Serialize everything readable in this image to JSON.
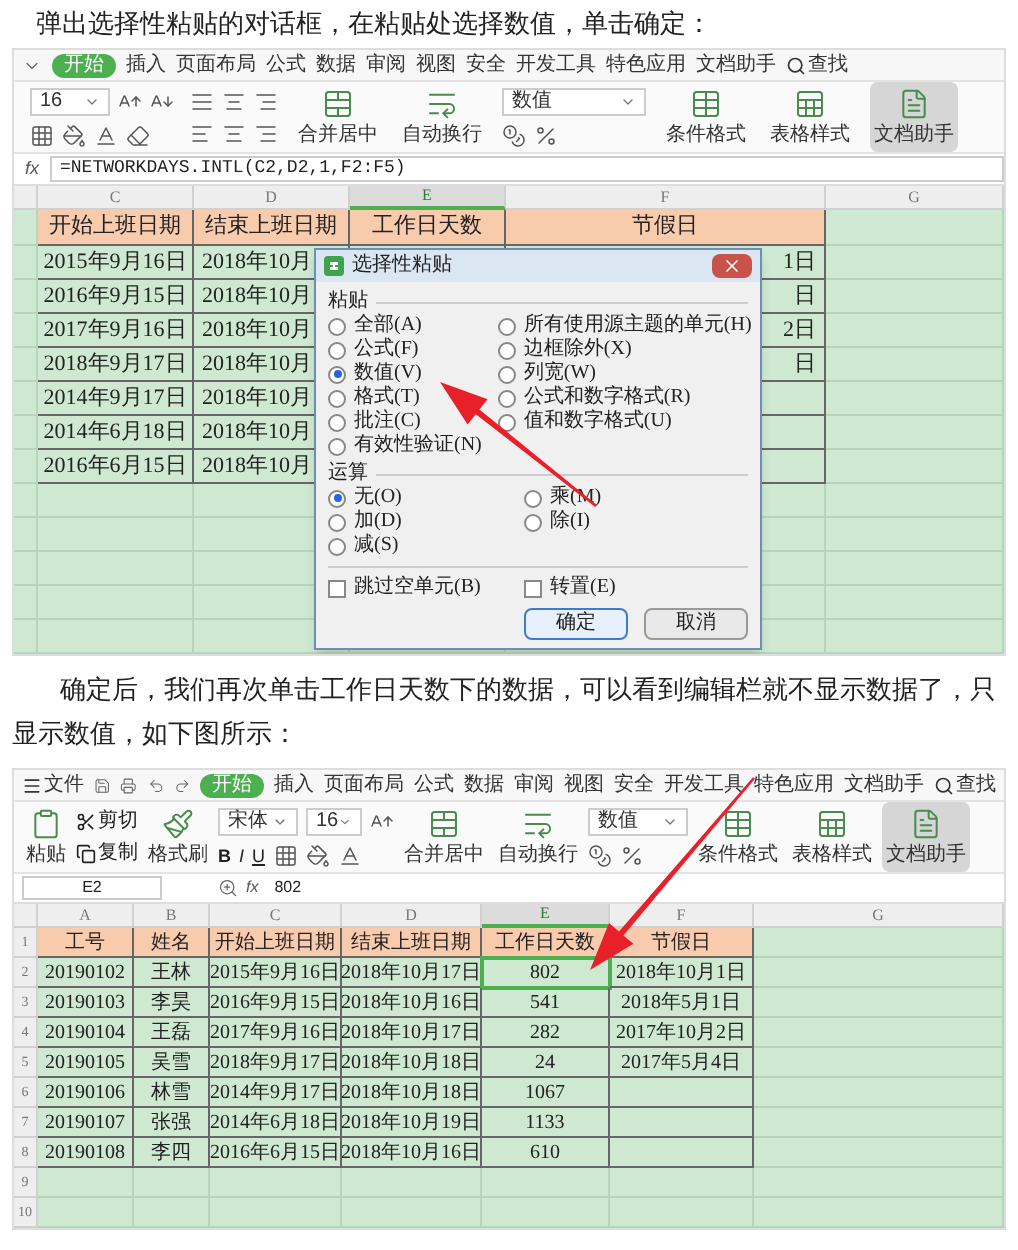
{
  "intro": "弹出选择性粘贴的对话框，在粘贴处选择数值，单击确定：",
  "screenshot_1": {
    "tabs": [
      {
        "label": "开始",
        "selected": true
      },
      {
        "label": "插入",
        "selected": false
      },
      {
        "label": "页面布局",
        "selected": false
      },
      {
        "label": "公式",
        "selected": false
      },
      {
        "label": "数据",
        "selected": false
      },
      {
        "label": "审阅",
        "selected": false
      },
      {
        "label": "视图",
        "selected": false
      },
      {
        "label": "安全",
        "selected": false
      },
      {
        "label": "开发工具",
        "selected": false
      },
      {
        "label": "特色应用",
        "selected": false
      },
      {
        "label": "文档助手",
        "selected": false
      }
    ],
    "search": "查找",
    "ribbon": {
      "font_size": "16",
      "merge": "合并居中",
      "wrap": "自动换行",
      "number_format": "数值",
      "conditional": "条件格式",
      "table_style": "表格样式",
      "assistant": "文档助手"
    },
    "formula": {
      "fx": "fx",
      "value": "=NETWORKDAYS.INTL(C2,D2,1,F2:F5)"
    },
    "columns": [
      {
        "label": "C",
        "selected": false
      },
      {
        "label": "D",
        "selected": false
      },
      {
        "label": "E",
        "selected": true
      },
      {
        "label": "F",
        "selected": false
      },
      {
        "label": "G",
        "selected": false
      }
    ],
    "header": [
      "开始上班日期",
      "结束上班日期",
      "工作日天数",
      "节假日"
    ],
    "rows": [
      {
        "start": "2015年9月16日",
        "end": "2018年10月",
        "holiday": "1日"
      },
      {
        "start": "2016年9月15日",
        "end": "2018年10月",
        "holiday": "日"
      },
      {
        "start": "2017年9月16日",
        "end": "2018年10月",
        "holiday": "2日"
      },
      {
        "start": "2018年9月17日",
        "end": "2018年10月",
        "holiday": "日"
      },
      {
        "start": "2014年9月17日",
        "end": "2018年10月"
      },
      {
        "start": "2014年6月18日",
        "end": "2018年10月"
      },
      {
        "start": "2016年6月15日",
        "end": "2018年10月"
      }
    ],
    "dialog": {
      "title": "选择性粘贴",
      "paste_label": "粘贴",
      "paste_left": [
        {
          "label": "全部(A)",
          "selected": false
        },
        {
          "label": "公式(F)",
          "selected": false
        },
        {
          "label": "数值(V)",
          "selected": true
        },
        {
          "label": "格式(T)",
          "selected": false
        },
        {
          "label": "批注(C)",
          "selected": false
        },
        {
          "label": "有效性验证(N)",
          "selected": false
        }
      ],
      "paste_right": [
        {
          "label": "所有使用源主题的单元(H)",
          "selected": false
        },
        {
          "label": "边框除外(X)",
          "selected": false
        },
        {
          "label": "列宽(W)",
          "selected": false
        },
        {
          "label": "公式和数字格式(R)",
          "selected": false
        },
        {
          "label": "值和数字格式(U)",
          "selected": false
        }
      ],
      "operation_label": "运算",
      "operation_left": [
        {
          "label": "无(O)",
          "selected": true
        },
        {
          "label": "加(D)",
          "selected": false
        },
        {
          "label": "减(S)",
          "selected": false
        }
      ],
      "operation_right": [
        {
          "label": "乘(M)",
          "selected": false
        },
        {
          "label": "除(I)",
          "selected": false
        }
      ],
      "checkboxes": [
        {
          "label": "跳过空单元(B)",
          "checked": false
        },
        {
          "label": "转置(E)",
          "checked": false
        }
      ],
      "buttons": [
        {
          "label": "确定",
          "kind": "primary"
        },
        {
          "label": "取消",
          "kind": "normal"
        }
      ]
    }
  },
  "body_text": "确定后，我们再次单击工作日天数下的数据，可以看到编辑栏就不显示数据了，只显示数值，如下图所示：",
  "screenshot_2": {
    "menu": "文件",
    "tabs": [
      {
        "label": "开始",
        "selected": true
      },
      {
        "label": "插入",
        "selected": false
      },
      {
        "label": "页面布局",
        "selected": false
      },
      {
        "label": "公式",
        "selected": false
      },
      {
        "label": "数据",
        "selected": false
      },
      {
        "label": "审阅",
        "selected": false
      },
      {
        "label": "视图",
        "selected": false
      },
      {
        "label": "安全",
        "selected": false
      },
      {
        "label": "开发工具",
        "selected": false
      },
      {
        "label": "特色应用",
        "selected": false
      },
      {
        "label": "文档助手",
        "selected": false
      }
    ],
    "search": "查找",
    "ribbon": {
      "paste": "粘贴",
      "cut": "剪切",
      "copy": "复制",
      "painter": "格式刷",
      "font": "宋体",
      "font_size": "16",
      "bold": "B",
      "italic": "I",
      "underline": "U",
      "merge": "合并居中",
      "wrap": "自动换行",
      "number_format": "数值",
      "conditional": "条件格式",
      "table_style": "表格样式",
      "assistant": "文档助手"
    },
    "name_box": "E2",
    "fx": "fx",
    "formula": "802",
    "columns": [
      {
        "label": "A",
        "selected": false
      },
      {
        "label": "B",
        "selected": false
      },
      {
        "label": "C",
        "selected": false
      },
      {
        "label": "D",
        "selected": false
      },
      {
        "label": "E",
        "selected": true
      },
      {
        "label": "F",
        "selected": false
      },
      {
        "label": "G",
        "selected": false
      }
    ],
    "row_numbers": [
      "1",
      "2",
      "3",
      "4",
      "5",
      "6",
      "7",
      "8",
      "9",
      "10"
    ],
    "header": [
      "工号",
      "姓名",
      "开始上班日期",
      "结束上班日期",
      "工作日天数",
      "节假日"
    ],
    "rows": [
      {
        "cells": [
          "20190102",
          "王林",
          "2015年9月16日",
          "2018年10月17日",
          "802",
          "2018年10月1日"
        ],
        "selected": true
      },
      {
        "cells": [
          "20190103",
          "李昊",
          "2016年9月15日",
          "2018年10月16日",
          "541",
          "2018年5月1日"
        ],
        "selected": false
      },
      {
        "cells": [
          "20190104",
          "王磊",
          "2017年9月16日",
          "2018年10月17日",
          "282",
          "2017年10月2日"
        ],
        "selected": false
      },
      {
        "cells": [
          "20190105",
          "吴雪",
          "2018年9月17日",
          "2018年10月18日",
          "24",
          "2017年5月4日"
        ],
        "selected": false
      },
      {
        "cells": [
          "20190106",
          "林雪",
          "2014年9月17日",
          "2018年10月18日",
          "1067"
        ],
        "selected": false
      },
      {
        "cells": [
          "20190107",
          "张强",
          "2014年6月18日",
          "2018年10月19日",
          "1133"
        ],
        "selected": false
      },
      {
        "cells": [
          "20190108",
          "李四",
          "2016年6月15日",
          "2018年10月16日",
          "610"
        ],
        "selected": false
      }
    ]
  }
}
